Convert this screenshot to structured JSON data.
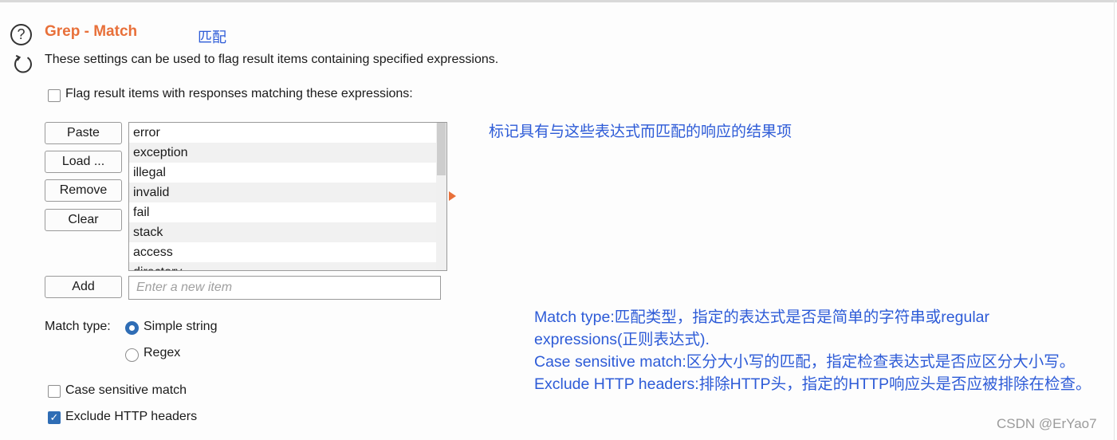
{
  "header": {
    "title": "Grep - Match",
    "title_annotation": "匹配",
    "description": "These settings can be used to flag result items containing specified expressions."
  },
  "flag_checkbox": {
    "label": "Flag result items with responses matching these expressions:",
    "checked": false
  },
  "buttons": {
    "paste": "Paste",
    "load": "Load ...",
    "remove": "Remove",
    "clear": "Clear",
    "add": "Add"
  },
  "expressions": [
    "error",
    "exception",
    "illegal",
    "invalid",
    "fail",
    "stack",
    "access",
    "directory"
  ],
  "new_item": {
    "placeholder": "Enter a new item",
    "value": ""
  },
  "match_type": {
    "label": "Match type:",
    "options": [
      "Simple string",
      "Regex"
    ],
    "selected": "Simple string"
  },
  "case_sensitive": {
    "label": "Case sensitive match",
    "checked": false
  },
  "exclude_headers": {
    "label": "Exclude HTTP headers",
    "checked": true
  },
  "annotations": {
    "list_note": "标记具有与这些表达式而匹配的响应的结果项",
    "block": [
      "Match type:匹配类型，指定的表达式是否是简单的字符串或regular",
      "expressions(正则表达式).",
      "Case sensitive match:区分大小写的匹配，指定检查表达式是否应区分大小写。",
      "Exclude HTTP headers:排除HTTP头，指定的HTTP响应头是否应被排除在检查。"
    ]
  },
  "watermark": "CSDN @ErYao7",
  "colors": {
    "title": "#e8703a",
    "annotation": "#2d5bd7",
    "accent": "#2f6db5"
  },
  "icons": {
    "help": "help-circle-icon",
    "refresh": "refresh-icon"
  }
}
